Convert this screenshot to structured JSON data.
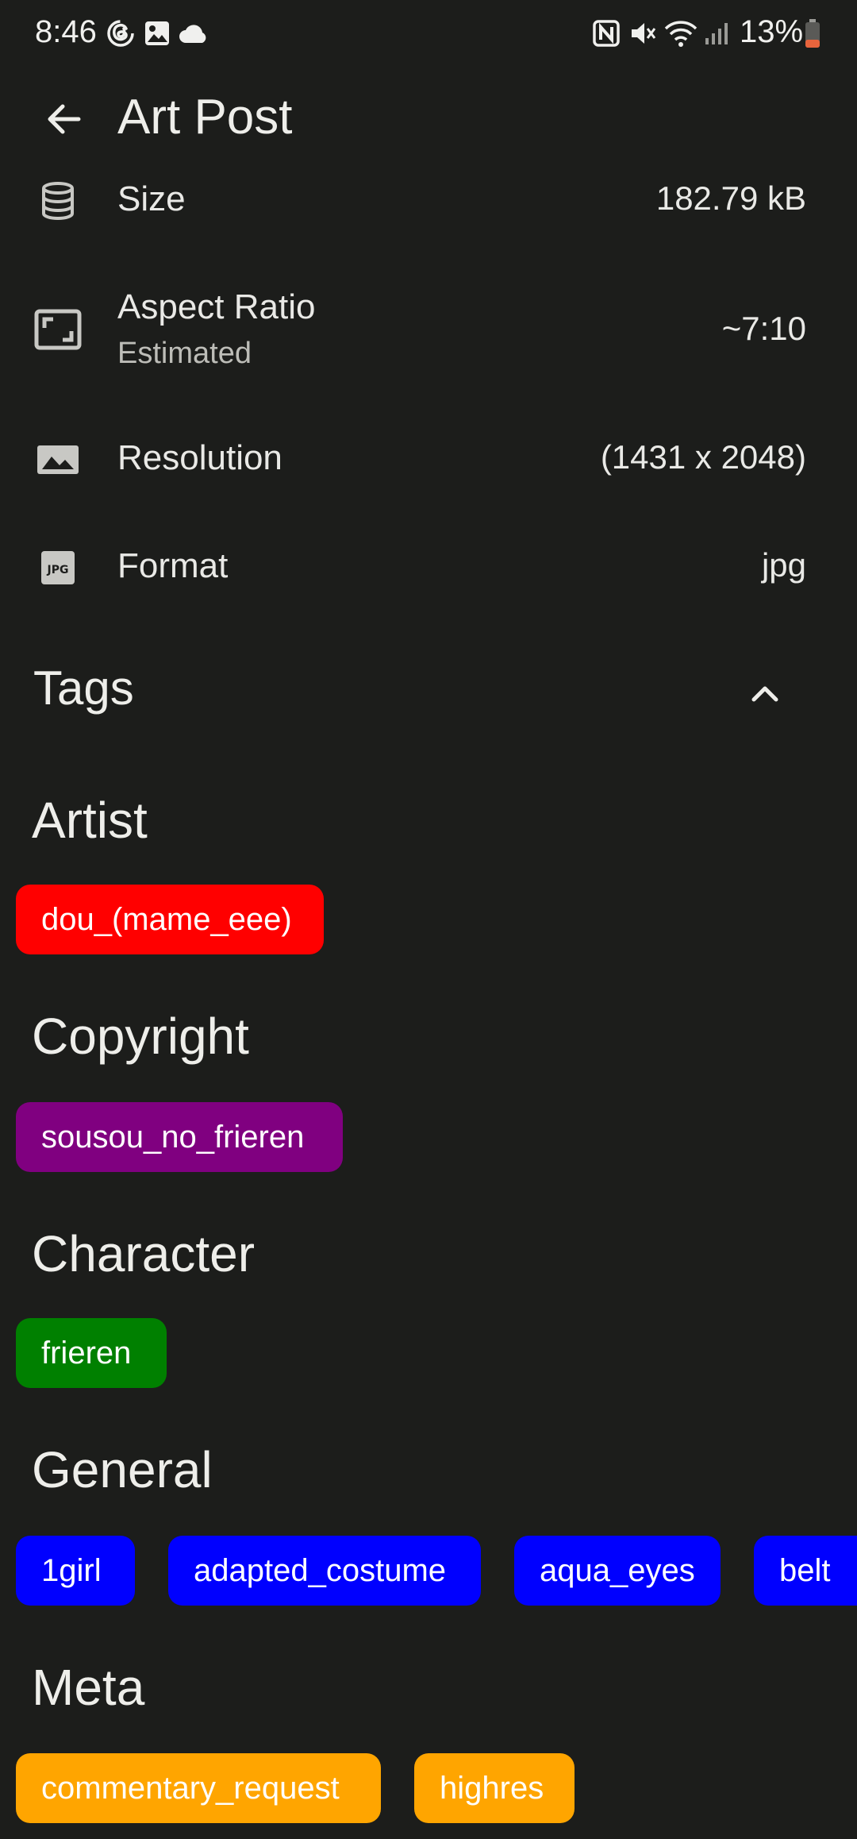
{
  "status_bar": {
    "time": "8:46",
    "battery": "13%",
    "icons": [
      "threads-icon",
      "gallery-icon",
      "cloud-icon",
      "nfc-icon",
      "mute-icon",
      "wifi-icon",
      "signal-icon",
      "battery-icon"
    ]
  },
  "app_bar": {
    "title": "Art Post",
    "back_icon": "arrow-left-icon"
  },
  "info": {
    "size": {
      "label": "Size",
      "value": "182.79 kB",
      "icon": "database-icon"
    },
    "aspect": {
      "label": "Aspect Ratio",
      "sublabel": "Estimated",
      "value": "~7:10",
      "icon": "aspect-ratio-icon"
    },
    "resolution": {
      "label": "Resolution",
      "value": "(1431 x 2048)",
      "icon": "image-icon"
    },
    "format": {
      "label": "Format",
      "value": "jpg",
      "icon": "jpg-file-icon"
    }
  },
  "tags": {
    "title": "Tags",
    "toggle_icon": "chevron-up-icon",
    "sections": {
      "artist": {
        "title": "Artist",
        "color": "#ff0000",
        "tags": [
          "dou_(mame_eee)"
        ]
      },
      "copyright": {
        "title": "Copyright",
        "color": "#800080",
        "tags": [
          "sousou_no_frieren"
        ]
      },
      "character": {
        "title": "Character",
        "color": "#008000",
        "tags": [
          "frieren"
        ]
      },
      "general": {
        "title": "General",
        "color": "#0000ff",
        "tags": [
          "1girl",
          "adapted_costume",
          "aqua_eyes",
          "belt"
        ]
      },
      "meta": {
        "title": "Meta",
        "color": "#ffa500",
        "tags": [
          "commentary_request",
          "highres"
        ]
      }
    }
  }
}
